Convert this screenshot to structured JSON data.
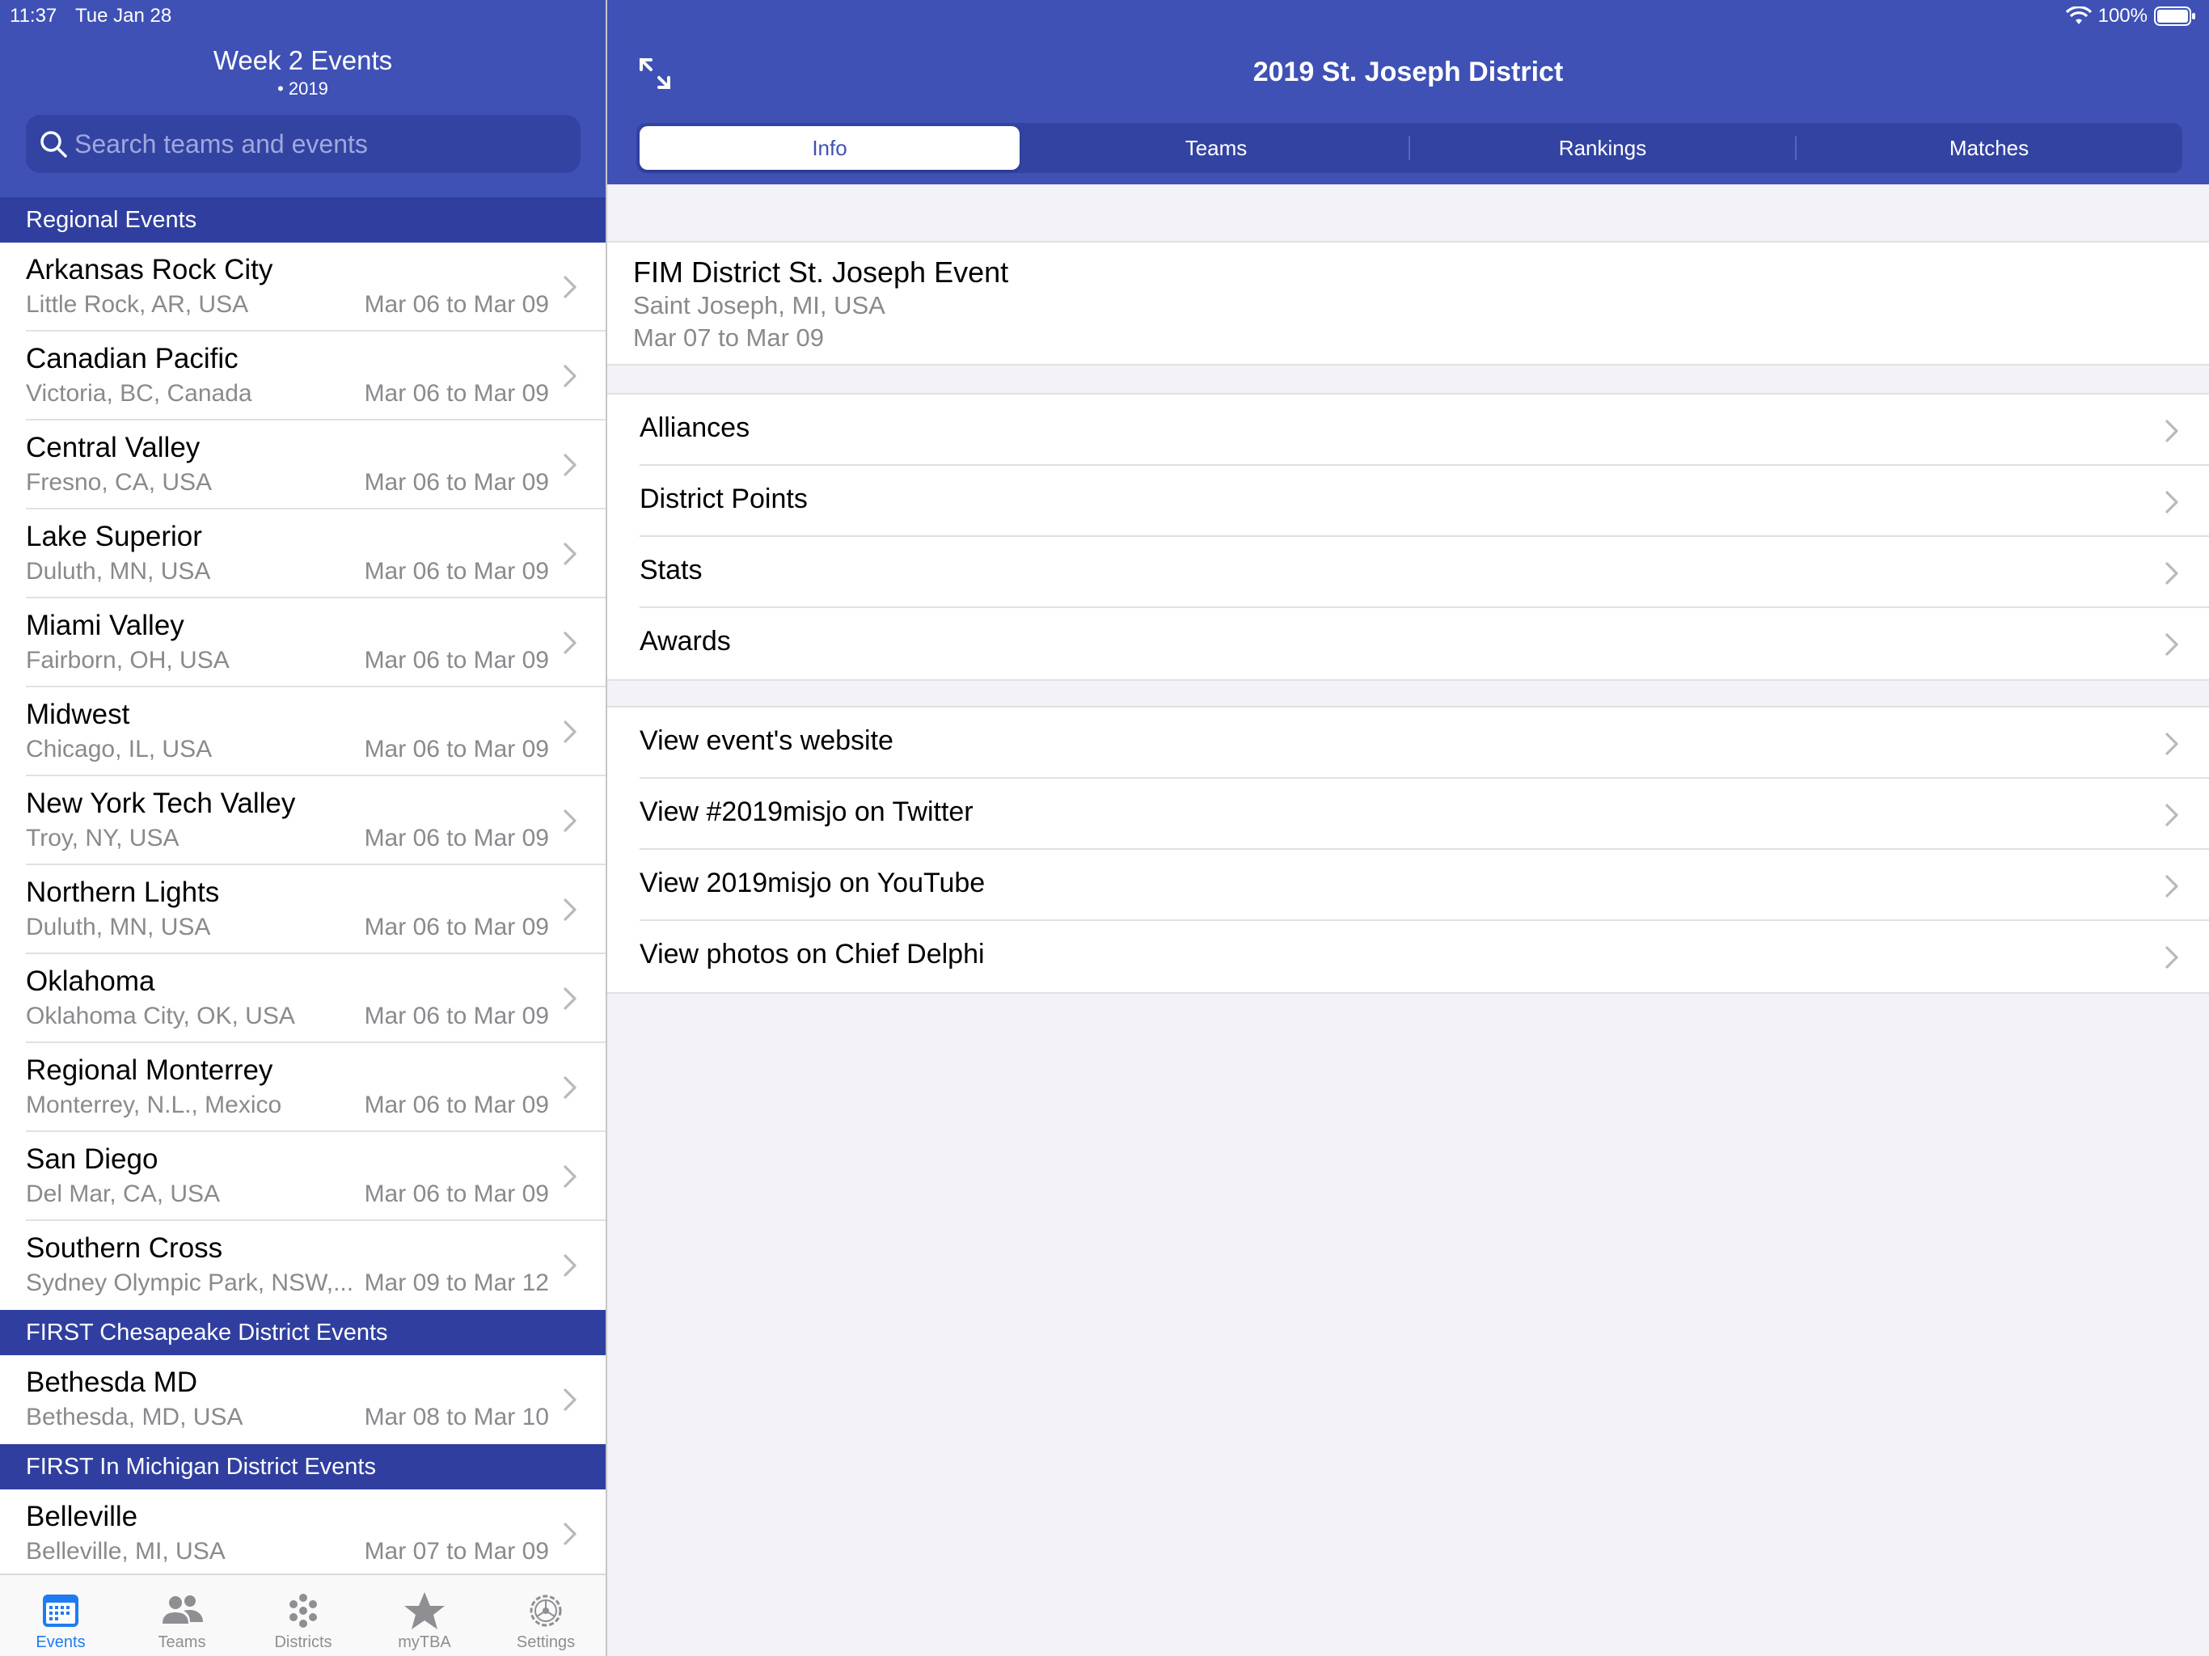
{
  "status_bar": {
    "time": "11:37",
    "date": "Tue Jan 28",
    "battery": "100%"
  },
  "left": {
    "title": "Week 2 Events",
    "subtitle": "• 2019",
    "search_placeholder": "Search teams and events",
    "sections": [
      {
        "header": "Regional Events",
        "events": [
          {
            "name": "Arkansas Rock City",
            "location": "Little Rock, AR, USA",
            "dates": "Mar 06 to Mar 09"
          },
          {
            "name": "Canadian Pacific",
            "location": "Victoria, BC, Canada",
            "dates": "Mar 06 to Mar 09"
          },
          {
            "name": "Central Valley",
            "location": "Fresno, CA, USA",
            "dates": "Mar 06 to Mar 09"
          },
          {
            "name": "Lake Superior",
            "location": "Duluth, MN, USA",
            "dates": "Mar 06 to Mar 09"
          },
          {
            "name": "Miami Valley",
            "location": "Fairborn, OH, USA",
            "dates": "Mar 06 to Mar 09"
          },
          {
            "name": "Midwest",
            "location": "Chicago, IL, USA",
            "dates": "Mar 06 to Mar 09"
          },
          {
            "name": "New York Tech Valley",
            "location": "Troy, NY, USA",
            "dates": "Mar 06 to Mar 09"
          },
          {
            "name": "Northern Lights",
            "location": "Duluth, MN, USA",
            "dates": "Mar 06 to Mar 09"
          },
          {
            "name": "Oklahoma",
            "location": "Oklahoma City, OK, USA",
            "dates": "Mar 06 to Mar 09"
          },
          {
            "name": "Regional Monterrey",
            "location": "Monterrey, N.L., Mexico",
            "dates": "Mar 06 to Mar 09"
          },
          {
            "name": "San Diego",
            "location": "Del Mar, CA, USA",
            "dates": "Mar 06 to Mar 09"
          },
          {
            "name": "Southern Cross",
            "location": "Sydney Olympic Park, NSW,...",
            "dates": "Mar 09 to Mar 12"
          }
        ]
      },
      {
        "header": "FIRST Chesapeake District Events",
        "events": [
          {
            "name": "Bethesda MD",
            "location": "Bethesda, MD, USA",
            "dates": "Mar 08 to Mar 10"
          }
        ]
      },
      {
        "header": "FIRST In Michigan District Events",
        "events": [
          {
            "name": "Belleville",
            "location": "Belleville, MI, USA",
            "dates": "Mar 07 to Mar 09"
          }
        ]
      }
    ],
    "tabs": [
      {
        "label": "Events",
        "icon": "calendar-icon",
        "active": true
      },
      {
        "label": "Teams",
        "icon": "people-icon",
        "active": false
      },
      {
        "label": "Districts",
        "icon": "districts-icon",
        "active": false
      },
      {
        "label": "myTBA",
        "icon": "star-icon",
        "active": false
      },
      {
        "label": "Settings",
        "icon": "gear-icon",
        "active": false
      }
    ]
  },
  "right": {
    "title": "2019 St. Joseph District",
    "segments": [
      "Info",
      "Teams",
      "Rankings",
      "Matches"
    ],
    "active_segment": "Info",
    "event": {
      "name": "FIM District St. Joseph Event",
      "location": "Saint Joseph, MI, USA",
      "dates": "Mar 07 to Mar 09"
    },
    "group1": [
      "Alliances",
      "District Points",
      "Stats",
      "Awards"
    ],
    "group2": [
      "View event's website",
      "View #2019misjo on Twitter",
      "View 2019misjo on YouTube",
      "View photos on Chief Delphi"
    ]
  },
  "colors": {
    "primary": "#3f51b5",
    "primary_dark": "#303f9f",
    "search_bg": "#3343a2",
    "tab_active": "#1e7cf2",
    "tab_inactive": "#8e8e93",
    "secondary_text": "#8a8a8e"
  }
}
